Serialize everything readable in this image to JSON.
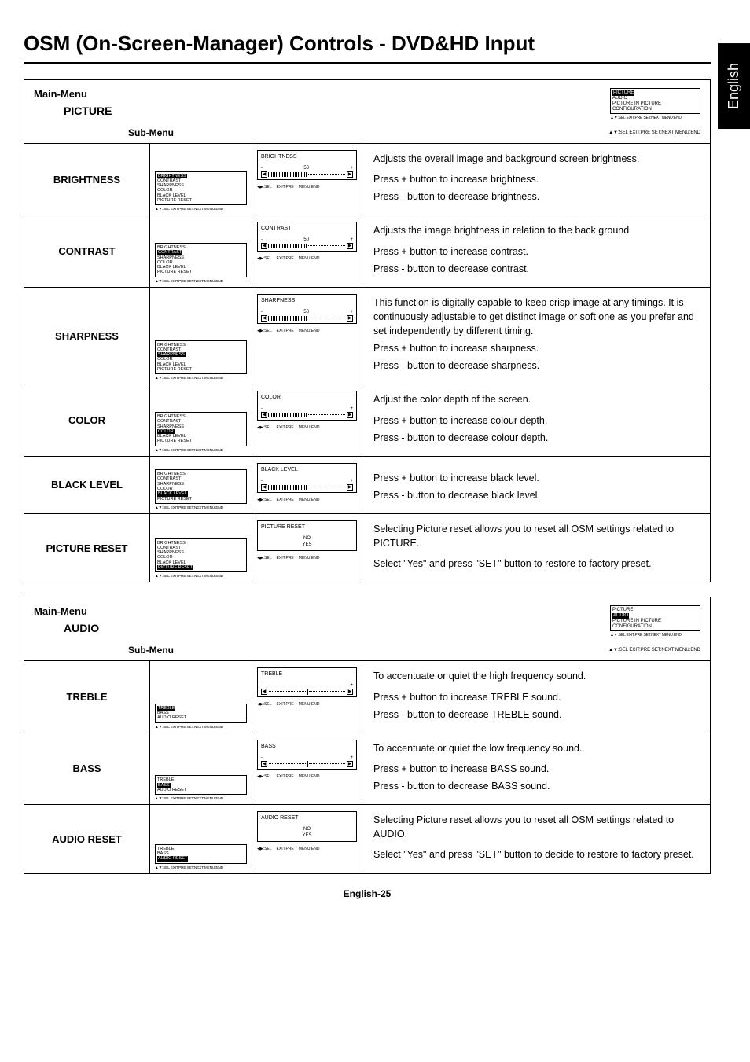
{
  "sideTab": "English",
  "pageTitle": "OSM (On-Screen-Manager) Controls - DVD&HD Input",
  "footer": "English-25",
  "labels": {
    "mainMenu": "Main-Menu",
    "subMenu": "Sub-Menu"
  },
  "topMenuItems": [
    "PICTURE",
    "AUDIO",
    "PICTURE IN PICTURE",
    "CONFIGURATION"
  ],
  "navFoot": "▲▼:SEL EXIT:PRE SET:NEXT MENU:END",
  "sliderFoot": {
    "a": "◀▶:SEL",
    "b": "EXIT:PRE",
    "c": "MENU:END"
  },
  "sections": [
    {
      "id": "picture",
      "mainTitle": "PICTURE",
      "highlightIndex": 0,
      "subItems": [
        "BRIGHTNESS",
        "CONTRAST",
        "SHARPNESS",
        "COLOR",
        "BLACK LEVEL",
        "PICTURE RESET"
      ],
      "rows": [
        {
          "label": "BRIGHTNESS",
          "hl": 0,
          "slider": {
            "title": "BRIGHTNESS",
            "type": "bar",
            "value": "50",
            "fill": 50
          },
          "desc": [
            "Adjusts the overall image and background screen brightness.",
            "",
            "Press + button to increase brightness.",
            "Press - button to decrease brightness."
          ]
        },
        {
          "label": "CONTRAST",
          "hl": 1,
          "slider": {
            "title": "CONTRAST",
            "type": "bar",
            "value": "50",
            "fill": 50
          },
          "desc": [
            "Adjusts the image brightness in relation to the back ground",
            "",
            "Press + button to increase contrast.",
            "Press - button to decrease contrast."
          ]
        },
        {
          "label": "SHARPNESS",
          "hl": 2,
          "slider": {
            "title": "SHARPNESS",
            "type": "bar",
            "value": "50",
            "fill": 50
          },
          "desc": [
            "This function is digitally capable to keep crisp image at any timings. It is continuously adjustable to get distinct image or soft one as you prefer and set independently by different timing.",
            "Press + button to increase sharpness.",
            "Press - button to decrease sharpness."
          ]
        },
        {
          "label": "COLOR",
          "hl": 3,
          "slider": {
            "title": "COLOR",
            "type": "bar",
            "value": "",
            "fill": 50
          },
          "desc": [
            "Adjust the color depth of the screen.",
            "",
            "Press + button to increase colour depth.",
            "Press - button to decrease colour depth."
          ]
        },
        {
          "label": "BLACK LEVEL",
          "hl": 4,
          "slider": {
            "title": "BLACK LEVEL",
            "type": "bar",
            "value": "",
            "fill": 50
          },
          "desc": [
            "",
            "Press + button to increase black level.",
            "Press - button to decrease black level."
          ]
        },
        {
          "label": "PICTURE RESET",
          "hl": 5,
          "slider": {
            "title": "PICTURE RESET",
            "type": "opts",
            "opts": [
              "NO",
              "YES"
            ]
          },
          "desc": [
            "Selecting Picture reset allows you to reset all OSM settings related to PICTURE.",
            "",
            "Select \"Yes\" and press \"SET\" button to restore to factory preset."
          ]
        }
      ]
    },
    {
      "id": "audio",
      "mainTitle": "AUDIO",
      "highlightIndex": 1,
      "subItems": [
        "TREBLE",
        "BASS",
        "AUDIO RESET"
      ],
      "rows": [
        {
          "label": "TREBLE",
          "hl": 0,
          "slider": {
            "title": "TREBLE",
            "type": "center",
            "value": ""
          },
          "desc": [
            "To accentuate or quiet the high frequency sound.",
            "",
            "Press + button to increase TREBLE sound.",
            "Press - button to decrease TREBLE sound."
          ]
        },
        {
          "label": "BASS",
          "hl": 1,
          "slider": {
            "title": "BASS",
            "type": "center",
            "value": ""
          },
          "desc": [
            "To accentuate or quiet the low frequency sound.",
            "",
            "Press + button to increase BASS sound.",
            "Press - button to decrease BASS sound."
          ]
        },
        {
          "label": "AUDIO RESET",
          "hl": 2,
          "slider": {
            "title": "AUDIO RESET",
            "type": "opts",
            "opts": [
              "NO",
              "YES"
            ]
          },
          "desc": [
            "Selecting Picture reset allows you to reset all OSM settings related to AUDIO.",
            "",
            "Select \"Yes\" and press \"SET\" button to decide to restore to factory preset."
          ]
        }
      ]
    }
  ]
}
